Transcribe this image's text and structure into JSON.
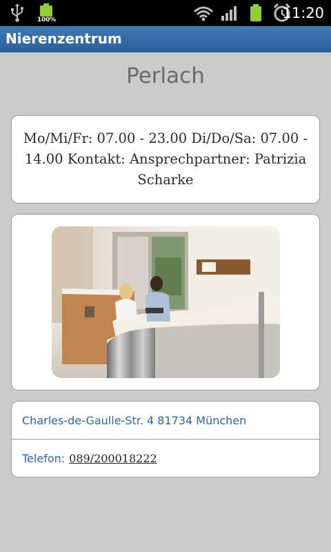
{
  "statusbar": {
    "battery_percent": "100%",
    "time": "11:20",
    "icons": [
      "usb-icon",
      "battery-icon",
      "wifi-icon",
      "signal-icon",
      "battery-icon",
      "alarm-icon"
    ]
  },
  "actionbar": {
    "title": "Nierenzentrum"
  },
  "page": {
    "title": "Perlach",
    "hours_text": "Mo/Mi/Fr: 07.00 - 23.00 Di/Do/Sa: 07.00 - 14.00 Kontakt: Ansprechpartner: Patrizia Scharke",
    "address": "Charles-de-Gaulle-Str. 4 81734 München",
    "phone_label": "Telefon:",
    "phone_number": "089/200018222"
  },
  "colors": {
    "background": "#cbcbcb",
    "actionbar": "#2f68a6",
    "link": "#2a66a8"
  }
}
